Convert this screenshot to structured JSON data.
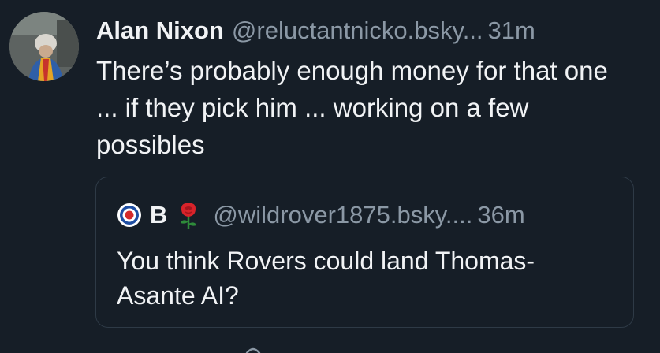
{
  "post": {
    "author": {
      "display_name": "Alan Nixon",
      "handle": "@reluctantnicko.bsky",
      "handle_ellipsis": "..."
    },
    "time": "31m",
    "text": "There’s probably enough money for that one ... if they pick him ... working on a few possibles"
  },
  "quote": {
    "author": {
      "display_name": "B",
      "handle": "@wildrover1875.bsky.",
      "handle_ellipsis": "..."
    },
    "time": "36m",
    "text": "You think Rovers could land Thomas-Asante AI?"
  },
  "icons": {
    "avatar": "avatar-photo",
    "roundel": "roundel-icon",
    "rose": "rose-icon",
    "action": "reply-icon"
  },
  "colors": {
    "background": "#161e27",
    "text_primary": "#f1f3f5",
    "text_secondary": "#8b98a5",
    "border": "#2e3a46"
  }
}
